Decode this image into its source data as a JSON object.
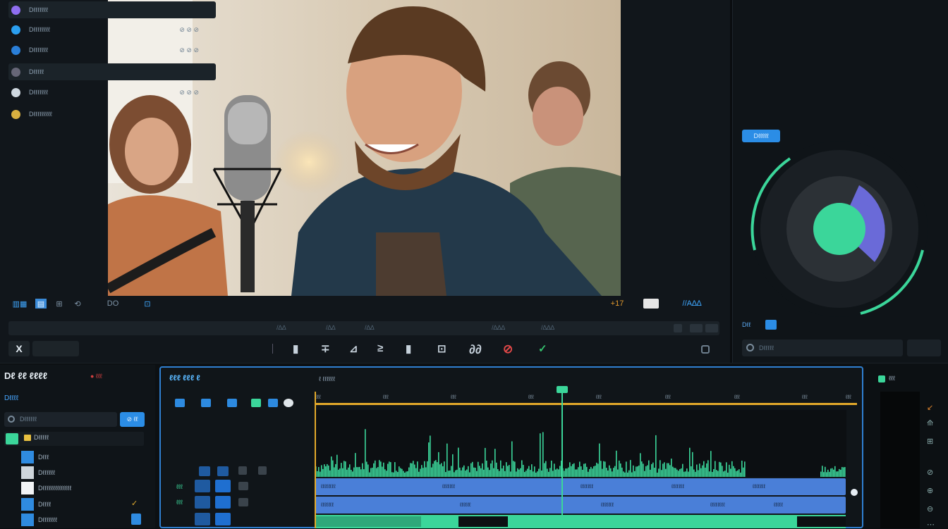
{
  "colors": {
    "accent": "#2b8de6",
    "green": "#3bd69a",
    "purple": "#6a6ad8",
    "red": "#d04040",
    "clip": "#4a7fd8"
  },
  "preview": {
    "toolbar_left": [
      "▥▦",
      "▤",
      "⊞",
      "⟲",
      "DO",
      "⊡",
      "⊡"
    ],
    "toolbar_right": {
      "count": "+17",
      "label": "//A∆∆"
    },
    "scrub_marks": [
      "/∆∆",
      "/∆∆",
      "/∆∆",
      "/∆∆∆",
      "/∆∆∆"
    ],
    "tools": [
      "X",
      "▮",
      "∓",
      "⊿",
      "≥",
      "▮",
      "⊡",
      "∂∂",
      "⊘",
      "✓"
    ]
  },
  "inspector": {
    "rows": [
      {
        "label": "Dℓℓℓℓℓℓℓ",
        "value": "",
        "color": "#8f6ef0"
      },
      {
        "label": "Dℓℓℓℓℓℓℓℓ",
        "value": "⊘ ⊘ ⊘",
        "color": "#2b9ff0"
      },
      {
        "label": "Dℓℓℓℓℓℓℓ",
        "value": "⊘ ⊘ ⊘",
        "color": "#2a7fd8"
      },
      {
        "label": "Dℓℓℓℓℓ",
        "value": "",
        "color": "#667"
      },
      {
        "label": "Dℓℓℓℓℓℓℓ",
        "value": "⊘ ⊘ ⊘",
        "color": "#cfd8e0"
      },
      {
        "label": "Dℓℓℓℓℓℓℓℓℓ",
        "value": "",
        "color": "#d8b040"
      }
    ],
    "chip": "Dℓℓℓℓℓ",
    "bottom_chip": "Dℓℓ",
    "search_placeholder": "Dℓℓℓℓℓ"
  },
  "media": {
    "title": "Dℓ ℓℓ ℓℓℓℓ",
    "badge": "● ℓℓℓ",
    "tab": "Dℓℓℓℓ",
    "search_placeholder": "Dℓℓℓℓℓℓ",
    "search_button": "⊘ ℓℓ",
    "folder": "Dℓℓℓℓℓ",
    "items": [
      "Dℓℓℓ",
      "Dℓℓℓℓℓℓ",
      "Dℓℓℓℓℓℓℓℓℓℓℓℓℓℓ",
      "Dℓℓℓℓ",
      "Dℓℓℓℓℓℓℓ"
    ]
  },
  "timeline": {
    "title": "ℓℓℓ ℓℓℓ ℓ",
    "header_label": "ℓ ℓℓℓℓℓℓ",
    "ruler": [
      "ℓℓℓ",
      "ℓℓℓ",
      "ℓℓℓ",
      "ℓℓℓ",
      "ℓℓℓ",
      "ℓℓℓ",
      "ℓℓℓ",
      "ℓℓℓ",
      "ℓℓℓ"
    ],
    "track1": [
      "ℓℓℓℓℓℓℓℓ",
      "ℓℓℓℓℓℓℓ",
      "ℓℓℓℓℓℓℓ",
      "ℓℓℓℓℓℓℓ",
      "ℓℓℓℓℓℓℓ"
    ],
    "track2": [
      "ℓℓℓℓℓℓℓ",
      "ℓℓℓℓℓℓ",
      "ℓℓℓℓℓℓℓ",
      "ℓℓℓℓℓℓℓℓ",
      "ℓℓℓℓℓ"
    ],
    "track_labels": [
      "ℓℓℓ",
      "ℓℓℓ"
    ]
  },
  "right_strip": {
    "label": "ℓℓℓ"
  }
}
